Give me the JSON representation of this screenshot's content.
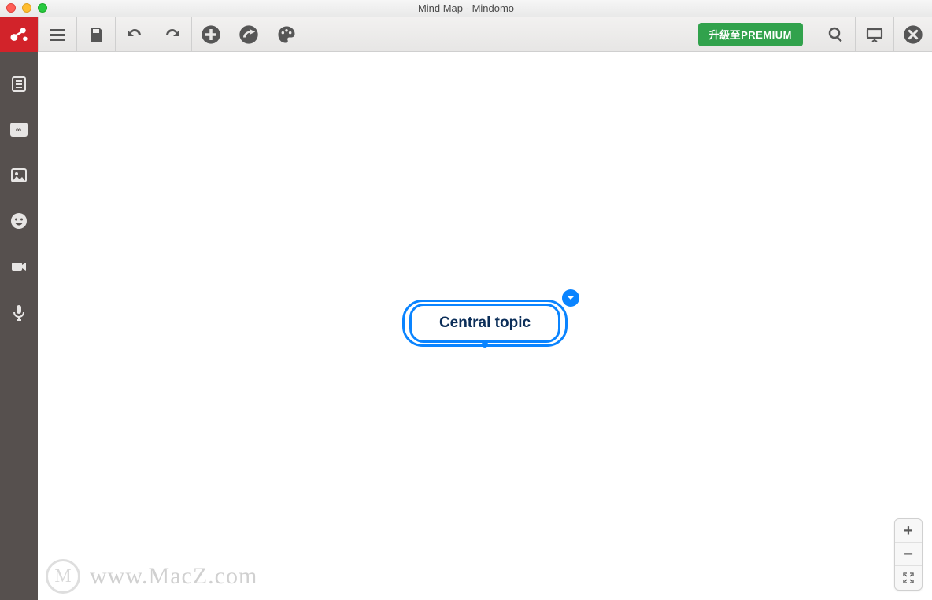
{
  "window": {
    "title": "Mind Map - Mindomo"
  },
  "toolbar": {
    "premium_label": "升級至PREMIUM"
  },
  "sidebar": {
    "link_label": "∞"
  },
  "canvas": {
    "central_topic": "Central topic"
  },
  "watermark": {
    "badge": "M",
    "text": "www.MacZ.com"
  }
}
